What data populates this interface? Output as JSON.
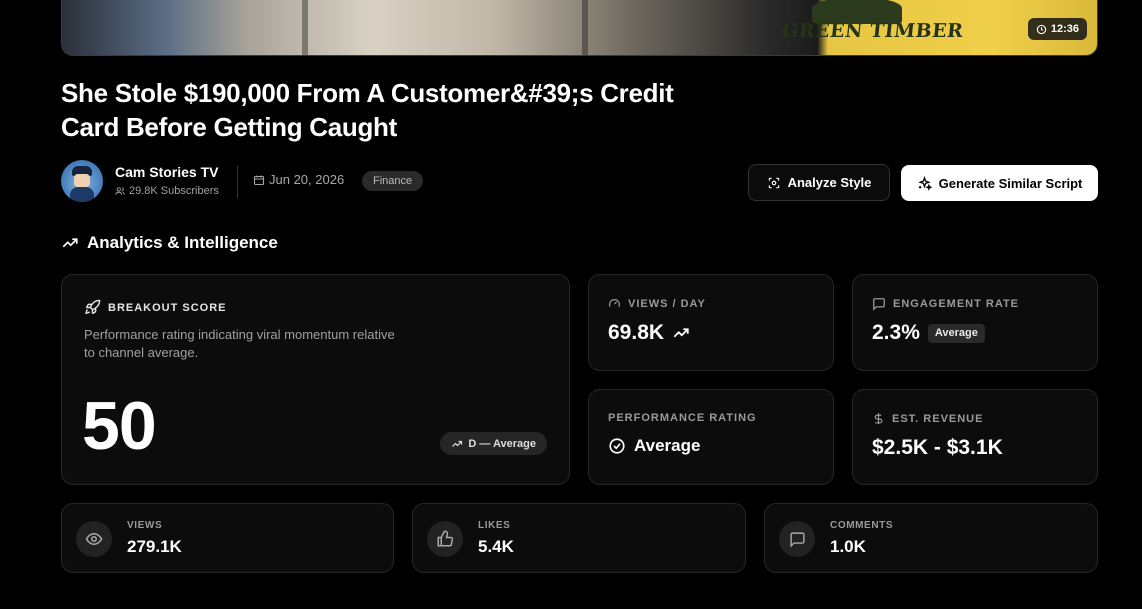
{
  "video": {
    "duration": "12:36",
    "thumbnail_sign_text": "GREEN TIMBER",
    "title": "She Stole $190,000 From A Customer&#39;s Credit Card Before Getting Caught"
  },
  "channel": {
    "name": "Cam Stories TV",
    "subscribers": "29.8K Subscribers",
    "date": "Jun 20, 2026",
    "category": "Finance"
  },
  "actions": {
    "analyze_label": "Analyze Style",
    "generate_label": "Generate Similar Script"
  },
  "analytics": {
    "section_title": "Analytics & Intelligence",
    "breakout": {
      "label": "BREAKOUT SCORE",
      "description": "Performance rating indicating viral momentum relative to channel average.",
      "score": "50",
      "grade": "D — Average"
    },
    "views_per_day": {
      "label": "VIEWS / DAY",
      "value": "69.8K"
    },
    "engagement": {
      "label": "ENGAGEMENT RATE",
      "value": "2.3%",
      "badge": "Average"
    },
    "performance": {
      "label": "PERFORMANCE RATING",
      "value": "Average"
    },
    "revenue": {
      "label": "EST. REVENUE",
      "value": "$2.5K - $3.1K"
    }
  },
  "stats": {
    "views": {
      "label": "VIEWS",
      "value": "279.1K"
    },
    "likes": {
      "label": "LIKES",
      "value": "5.4K"
    },
    "comments": {
      "label": "COMMENTS",
      "value": "1.0K"
    }
  },
  "icons": {
    "clock": "clock-icon",
    "users": "users-icon",
    "calendar": "calendar-icon",
    "scan": "scan-icon",
    "sparkles": "sparkles-icon",
    "trending": "trending-up-icon",
    "rocket": "rocket-icon",
    "gauge": "gauge-icon",
    "message": "message-square-icon",
    "check": "check-circle-icon",
    "dollar": "dollar-icon",
    "eye": "eye-icon",
    "thumbs_up": "thumbs-up-icon"
  },
  "colors": {
    "background": "#000000",
    "card": "#0c0c0c",
    "border": "#262626",
    "muted_text": "#9a9a9a",
    "primary_button": "#ffffff"
  }
}
